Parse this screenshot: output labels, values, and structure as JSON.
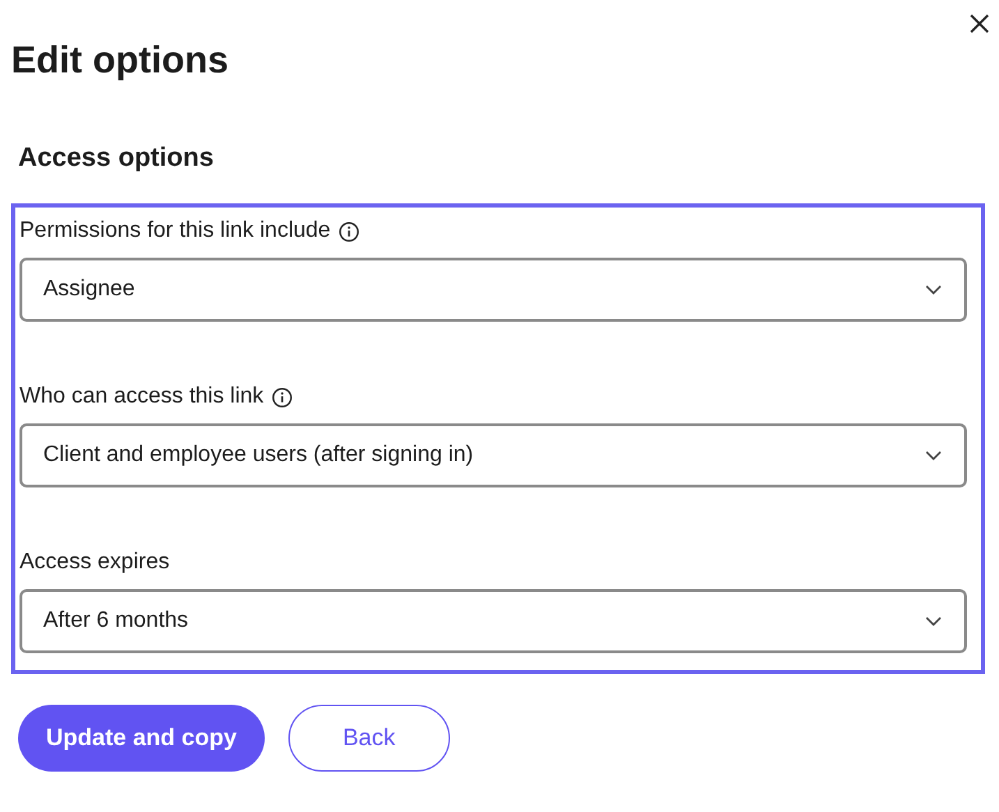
{
  "dialog": {
    "title": "Edit options",
    "section_title": "Access options",
    "fields": [
      {
        "label": "Permissions for this link include",
        "info": true,
        "value": "Assignee"
      },
      {
        "label": "Who can access this link",
        "info": true,
        "value": "Client and employee users (after signing in)"
      },
      {
        "label": "Access expires",
        "info": false,
        "value": "After 6 months"
      }
    ],
    "buttons": [
      {
        "label": "Update and copy",
        "kind": "primary"
      },
      {
        "label": "Back",
        "kind": "secondary"
      }
    ]
  }
}
